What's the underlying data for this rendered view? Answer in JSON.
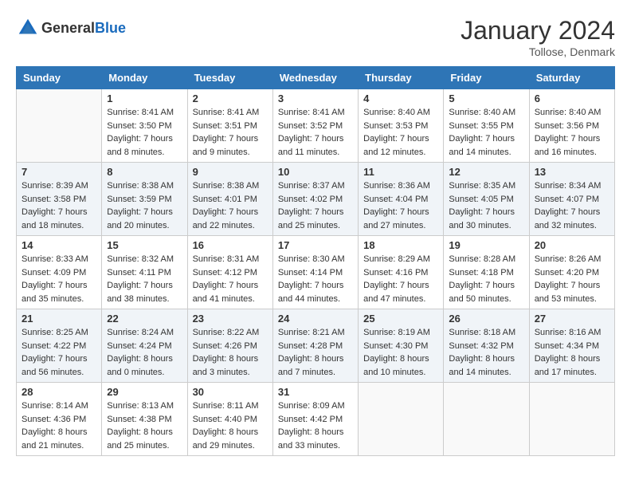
{
  "header": {
    "logo": {
      "text_general": "General",
      "text_blue": "Blue"
    },
    "title": "January 2024",
    "location": "Tollose, Denmark"
  },
  "calendar": {
    "days_of_week": [
      "Sunday",
      "Monday",
      "Tuesday",
      "Wednesday",
      "Thursday",
      "Friday",
      "Saturday"
    ],
    "weeks": [
      [
        {
          "day": "",
          "sunrise": "",
          "sunset": "",
          "daylight": ""
        },
        {
          "day": "1",
          "sunrise": "Sunrise: 8:41 AM",
          "sunset": "Sunset: 3:50 PM",
          "daylight": "Daylight: 7 hours and 8 minutes."
        },
        {
          "day": "2",
          "sunrise": "Sunrise: 8:41 AM",
          "sunset": "Sunset: 3:51 PM",
          "daylight": "Daylight: 7 hours and 9 minutes."
        },
        {
          "day": "3",
          "sunrise": "Sunrise: 8:41 AM",
          "sunset": "Sunset: 3:52 PM",
          "daylight": "Daylight: 7 hours and 11 minutes."
        },
        {
          "day": "4",
          "sunrise": "Sunrise: 8:40 AM",
          "sunset": "Sunset: 3:53 PM",
          "daylight": "Daylight: 7 hours and 12 minutes."
        },
        {
          "day": "5",
          "sunrise": "Sunrise: 8:40 AM",
          "sunset": "Sunset: 3:55 PM",
          "daylight": "Daylight: 7 hours and 14 minutes."
        },
        {
          "day": "6",
          "sunrise": "Sunrise: 8:40 AM",
          "sunset": "Sunset: 3:56 PM",
          "daylight": "Daylight: 7 hours and 16 minutes."
        }
      ],
      [
        {
          "day": "7",
          "sunrise": "Sunrise: 8:39 AM",
          "sunset": "Sunset: 3:58 PM",
          "daylight": "Daylight: 7 hours and 18 minutes."
        },
        {
          "day": "8",
          "sunrise": "Sunrise: 8:38 AM",
          "sunset": "Sunset: 3:59 PM",
          "daylight": "Daylight: 7 hours and 20 minutes."
        },
        {
          "day": "9",
          "sunrise": "Sunrise: 8:38 AM",
          "sunset": "Sunset: 4:01 PM",
          "daylight": "Daylight: 7 hours and 22 minutes."
        },
        {
          "day": "10",
          "sunrise": "Sunrise: 8:37 AM",
          "sunset": "Sunset: 4:02 PM",
          "daylight": "Daylight: 7 hours and 25 minutes."
        },
        {
          "day": "11",
          "sunrise": "Sunrise: 8:36 AM",
          "sunset": "Sunset: 4:04 PM",
          "daylight": "Daylight: 7 hours and 27 minutes."
        },
        {
          "day": "12",
          "sunrise": "Sunrise: 8:35 AM",
          "sunset": "Sunset: 4:05 PM",
          "daylight": "Daylight: 7 hours and 30 minutes."
        },
        {
          "day": "13",
          "sunrise": "Sunrise: 8:34 AM",
          "sunset": "Sunset: 4:07 PM",
          "daylight": "Daylight: 7 hours and 32 minutes."
        }
      ],
      [
        {
          "day": "14",
          "sunrise": "Sunrise: 8:33 AM",
          "sunset": "Sunset: 4:09 PM",
          "daylight": "Daylight: 7 hours and 35 minutes."
        },
        {
          "day": "15",
          "sunrise": "Sunrise: 8:32 AM",
          "sunset": "Sunset: 4:11 PM",
          "daylight": "Daylight: 7 hours and 38 minutes."
        },
        {
          "day": "16",
          "sunrise": "Sunrise: 8:31 AM",
          "sunset": "Sunset: 4:12 PM",
          "daylight": "Daylight: 7 hours and 41 minutes."
        },
        {
          "day": "17",
          "sunrise": "Sunrise: 8:30 AM",
          "sunset": "Sunset: 4:14 PM",
          "daylight": "Daylight: 7 hours and 44 minutes."
        },
        {
          "day": "18",
          "sunrise": "Sunrise: 8:29 AM",
          "sunset": "Sunset: 4:16 PM",
          "daylight": "Daylight: 7 hours and 47 minutes."
        },
        {
          "day": "19",
          "sunrise": "Sunrise: 8:28 AM",
          "sunset": "Sunset: 4:18 PM",
          "daylight": "Daylight: 7 hours and 50 minutes."
        },
        {
          "day": "20",
          "sunrise": "Sunrise: 8:26 AM",
          "sunset": "Sunset: 4:20 PM",
          "daylight": "Daylight: 7 hours and 53 minutes."
        }
      ],
      [
        {
          "day": "21",
          "sunrise": "Sunrise: 8:25 AM",
          "sunset": "Sunset: 4:22 PM",
          "daylight": "Daylight: 7 hours and 56 minutes."
        },
        {
          "day": "22",
          "sunrise": "Sunrise: 8:24 AM",
          "sunset": "Sunset: 4:24 PM",
          "daylight": "Daylight: 8 hours and 0 minutes."
        },
        {
          "day": "23",
          "sunrise": "Sunrise: 8:22 AM",
          "sunset": "Sunset: 4:26 PM",
          "daylight": "Daylight: 8 hours and 3 minutes."
        },
        {
          "day": "24",
          "sunrise": "Sunrise: 8:21 AM",
          "sunset": "Sunset: 4:28 PM",
          "daylight": "Daylight: 8 hours and 7 minutes."
        },
        {
          "day": "25",
          "sunrise": "Sunrise: 8:19 AM",
          "sunset": "Sunset: 4:30 PM",
          "daylight": "Daylight: 8 hours and 10 minutes."
        },
        {
          "day": "26",
          "sunrise": "Sunrise: 8:18 AM",
          "sunset": "Sunset: 4:32 PM",
          "daylight": "Daylight: 8 hours and 14 minutes."
        },
        {
          "day": "27",
          "sunrise": "Sunrise: 8:16 AM",
          "sunset": "Sunset: 4:34 PM",
          "daylight": "Daylight: 8 hours and 17 minutes."
        }
      ],
      [
        {
          "day": "28",
          "sunrise": "Sunrise: 8:14 AM",
          "sunset": "Sunset: 4:36 PM",
          "daylight": "Daylight: 8 hours and 21 minutes."
        },
        {
          "day": "29",
          "sunrise": "Sunrise: 8:13 AM",
          "sunset": "Sunset: 4:38 PM",
          "daylight": "Daylight: 8 hours and 25 minutes."
        },
        {
          "day": "30",
          "sunrise": "Sunrise: 8:11 AM",
          "sunset": "Sunset: 4:40 PM",
          "daylight": "Daylight: 8 hours and 29 minutes."
        },
        {
          "day": "31",
          "sunrise": "Sunrise: 8:09 AM",
          "sunset": "Sunset: 4:42 PM",
          "daylight": "Daylight: 8 hours and 33 minutes."
        },
        {
          "day": "",
          "sunrise": "",
          "sunset": "",
          "daylight": ""
        },
        {
          "day": "",
          "sunrise": "",
          "sunset": "",
          "daylight": ""
        },
        {
          "day": "",
          "sunrise": "",
          "sunset": "",
          "daylight": ""
        }
      ]
    ]
  }
}
